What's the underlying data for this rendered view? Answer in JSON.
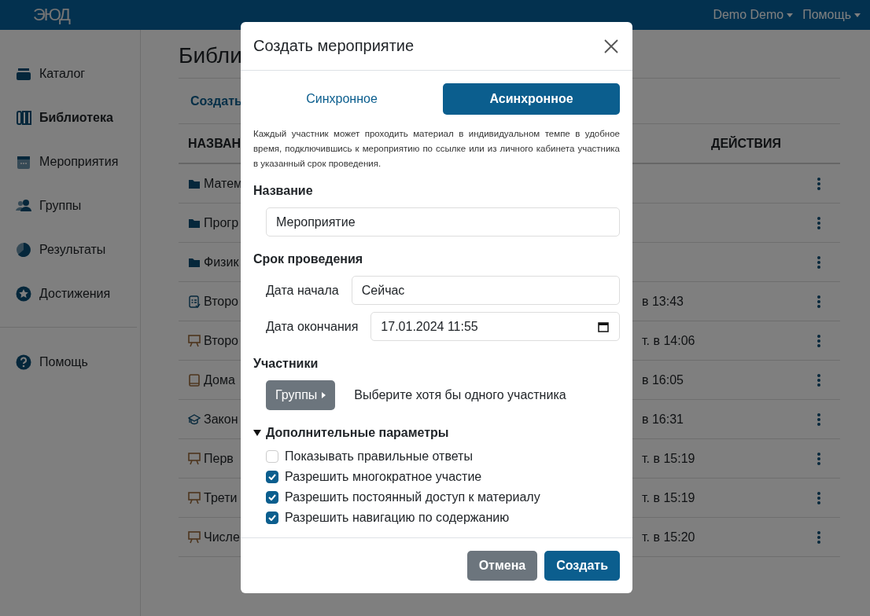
{
  "navbar": {
    "logo": "ЭЮД",
    "menus": [
      {
        "label": "Demo Demo"
      },
      {
        "label": "Помощь"
      }
    ]
  },
  "sidebar": {
    "items": [
      {
        "label": "Каталог",
        "selected": false
      },
      {
        "label": "Библиотека",
        "selected": true
      },
      {
        "label": "Мероприятия",
        "selected": false
      },
      {
        "label": "Группы",
        "selected": false
      },
      {
        "label": "Результаты",
        "selected": false
      },
      {
        "label": "Достижения",
        "selected": false
      }
    ],
    "footer_items": [
      {
        "label": "Помощь",
        "selected": false
      }
    ]
  },
  "main": {
    "title": "Библи",
    "create_link": "Создать",
    "table": {
      "columns": [
        "НАЗВАН",
        "ДЕЙСТВИЯ"
      ],
      "rows": [
        {
          "kind": "folder",
          "name": "Матем"
        },
        {
          "kind": "folder",
          "name": "Прогр"
        },
        {
          "kind": "folder",
          "name": "Физик"
        },
        {
          "kind": "test",
          "name": "Второ",
          "date": "в 13:43"
        },
        {
          "kind": "presentation",
          "name": "Второ",
          "date": "т. в 14:06"
        },
        {
          "kind": "book",
          "name": "Дома",
          "date": "в 16:05"
        },
        {
          "kind": "course",
          "name": "Закон",
          "date": "в 16:31"
        },
        {
          "kind": "presentation",
          "name": "Перв",
          "date": "т. в 15:19"
        },
        {
          "kind": "presentation",
          "name": "Трети",
          "date": "т. в 15:19"
        },
        {
          "kind": "presentation",
          "name": "Числе",
          "date": "т. в 15:20"
        }
      ]
    }
  },
  "dialog": {
    "title": "Создать мероприятие",
    "modes": [
      {
        "label": "Синхронное",
        "selected": false
      },
      {
        "label": "Асинхронное",
        "selected": true
      }
    ],
    "description": "Каждый участник может проходить материал в индивидуальном темпе в удобное время, подключившись к мероприятию по ссылке или из личного кабинета участника в указанный срок проведения.",
    "name_label": "Название",
    "name_value": "Мероприятие",
    "period_label": "Срок проведения",
    "start_label": "Дата начала",
    "start_value": "Сейчас",
    "end_label": "Дата окончания",
    "end_value": "17.01.2024 11:55",
    "participants_label": "Участники",
    "groups_button": "Группы",
    "participants_hint": "Выберите хотя бы одного участника",
    "advanced": {
      "label": "Дополнительные параметры",
      "expanded": true,
      "options": [
        {
          "label": "Показывать правильные ответы",
          "checked": false
        },
        {
          "label": "Разрешить многократное участие",
          "checked": true
        },
        {
          "label": "Разрешить постоянный доступ к материалу",
          "checked": true
        },
        {
          "label": "Разрешить навигацию по содержанию",
          "checked": true
        }
      ]
    },
    "buttons": [
      {
        "label": "Отмена",
        "kind": "secondary"
      },
      {
        "label": "Создать",
        "kind": "primary"
      }
    ]
  }
}
